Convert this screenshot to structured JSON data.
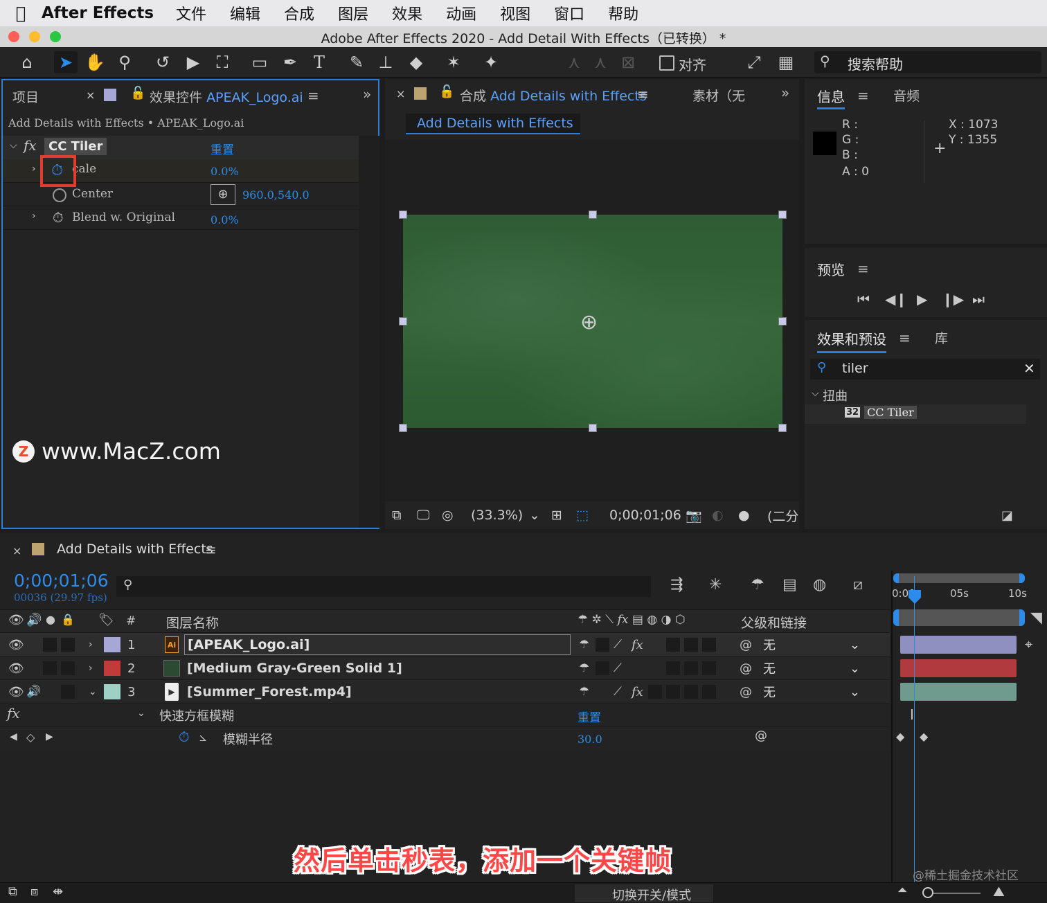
{
  "menubar": {
    "app_name": "After Effects",
    "items": [
      "文件",
      "编辑",
      "合成",
      "图层",
      "效果",
      "动画",
      "视图",
      "窗口",
      "帮助"
    ]
  },
  "window": {
    "title": "Adobe After Effects 2020 - Add Detail With Effects（已转换） *"
  },
  "toolbar": {
    "align_label": "对齐",
    "search_help_label": "搜索帮助"
  },
  "effect_controls": {
    "tab_project": "项目",
    "tab_effect_prefix": "效果控件",
    "tab_effect_layer": "APEAK_Logo.ai",
    "breadcrumb": "Add Details with Effects • APEAK_Logo.ai",
    "effect_name": "CC Tiler",
    "reset_label": "重置",
    "props": [
      {
        "label": "Scale",
        "value": "0.0%"
      },
      {
        "label": "Center",
        "value": "960.0,540.0"
      },
      {
        "label": "Blend w. Original",
        "value": "0.0%"
      }
    ],
    "scale_label_visible": "cale",
    "watermark": "www.MacZ.com"
  },
  "composition": {
    "tab_prefix": "合成",
    "tab_name": "Add Details with Effects",
    "footage_tab": "素材（无",
    "comp_button": "Add Details with Effects",
    "zoom": "(33.3%)",
    "timecode": "0;00;01;06",
    "resolution": "(二分"
  },
  "info_panel": {
    "tab_info": "信息",
    "tab_audio": "音频",
    "r": "R :",
    "g": "G :",
    "b": "B :",
    "a": "A :  0",
    "x": "X : 1073",
    "y": "Y :  1355"
  },
  "preview_panel": {
    "title": "预览"
  },
  "effects_presets": {
    "tab": "效果和预设",
    "tab_library": "库",
    "search_value": "tiler",
    "category": "扭曲",
    "item_badge": "32",
    "item": "CC Tiler"
  },
  "timeline": {
    "comp_name": "Add Details with Effects",
    "timecode": "0;00;01;06",
    "frame_info": "00036 (29.97 fps)",
    "col_hash": "#",
    "col_layer_name": "图层名称",
    "col_parent": "父级和链接",
    "ruler": [
      "0:00",
      "05s",
      "10s"
    ],
    "layers": [
      {
        "num": "1",
        "name": "[APEAK_Logo.ai]",
        "color": "#a7a7d6",
        "parent": "无",
        "bar_color": "#8f8fc0"
      },
      {
        "num": "2",
        "name": "[Medium Gray-Green Solid 1]",
        "color": "#c23a3a",
        "parent": "无",
        "bar_color": "#b13a3f"
      },
      {
        "num": "3",
        "name": "[Summer_Forest.mp4]",
        "color": "#9fd0c6",
        "parent": "无",
        "bar_color": "#6f9a8e"
      }
    ],
    "effect_name": "快速方框模糊",
    "effect_reset": "重置",
    "prop_name": "模糊半径",
    "prop_value": "30.0",
    "toggle_label": "切换开关/模式"
  },
  "subtitle": "然后单击秒表，添加一个关键帧",
  "corner_watermark": "@稀土掘金技术社区"
}
